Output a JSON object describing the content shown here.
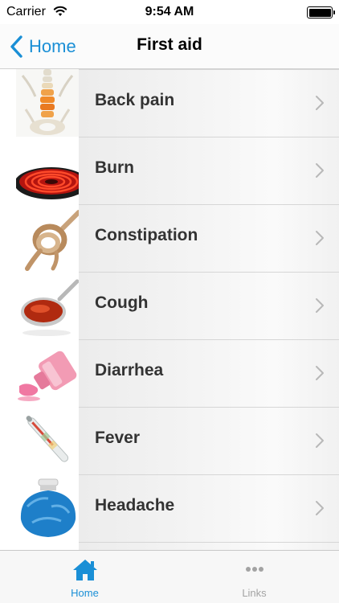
{
  "status_bar": {
    "carrier": "Carrier",
    "time": "9:54 AM"
  },
  "nav": {
    "back_label": "Home",
    "title": "First aid"
  },
  "list": {
    "items": [
      {
        "label": "Back pain",
        "icon": "spine-icon"
      },
      {
        "label": "Burn",
        "icon": "hot-stove-icon"
      },
      {
        "label": "Constipation",
        "icon": "knotted-rope-icon"
      },
      {
        "label": "Cough",
        "icon": "syrup-spoon-icon"
      },
      {
        "label": "Diarrhea",
        "icon": "medicine-bottle-icon"
      },
      {
        "label": "Fever",
        "icon": "thermometer-icon"
      },
      {
        "label": "Headache",
        "icon": "ice-bag-icon"
      }
    ]
  },
  "tab_bar": {
    "tabs": [
      {
        "label": "Home",
        "icon": "home-icon",
        "selected": true
      },
      {
        "label": "Links",
        "icon": "more-icon",
        "selected": false
      }
    ]
  },
  "colors": {
    "accent": "#1a8fd6",
    "inactive_tab": "#a3a3a3",
    "row_text": "#333333"
  }
}
